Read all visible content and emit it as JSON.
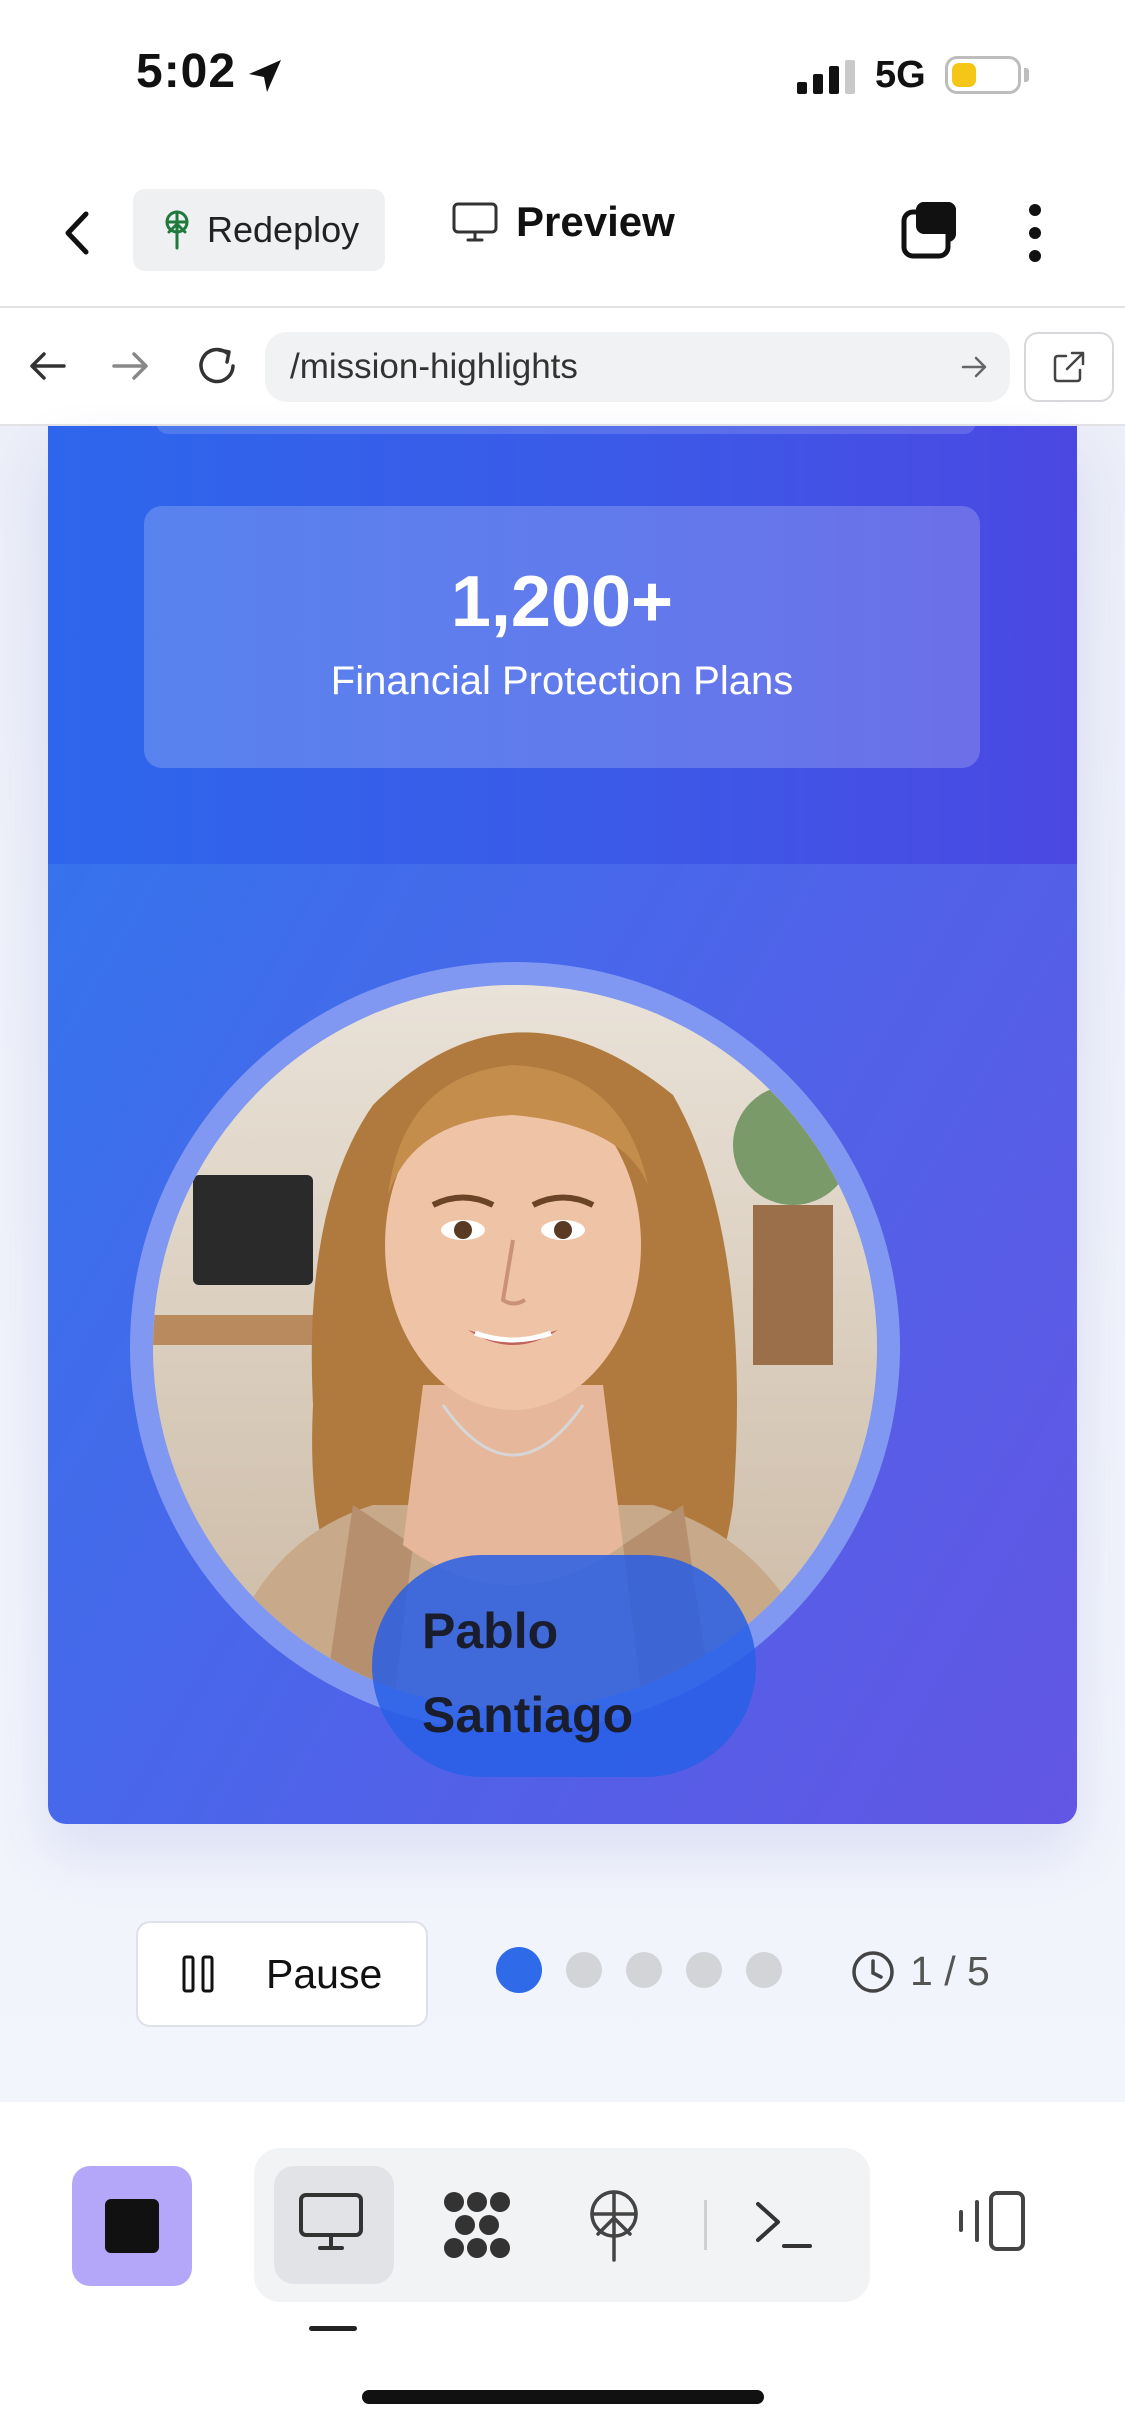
{
  "status_bar": {
    "time": "5:02",
    "network": "5G"
  },
  "header": {
    "redeploy_label": "Redeploy",
    "preview_label": "Preview"
  },
  "browser": {
    "url": "/mission-highlights"
  },
  "slide": {
    "stat_value": "1,200+",
    "stat_label": "Financial Protection Plans",
    "person_name": "Pablo Santiago"
  },
  "controls": {
    "pause_label": "Pause",
    "counter": "1 / 5",
    "current_slide": 1,
    "total_slides": 5
  },
  "colors": {
    "accent": "#2f6ae9",
    "stop_button": "#b4a6f8",
    "card_gradient_start": "#2d66ec",
    "card_gradient_end": "#6256e4"
  }
}
